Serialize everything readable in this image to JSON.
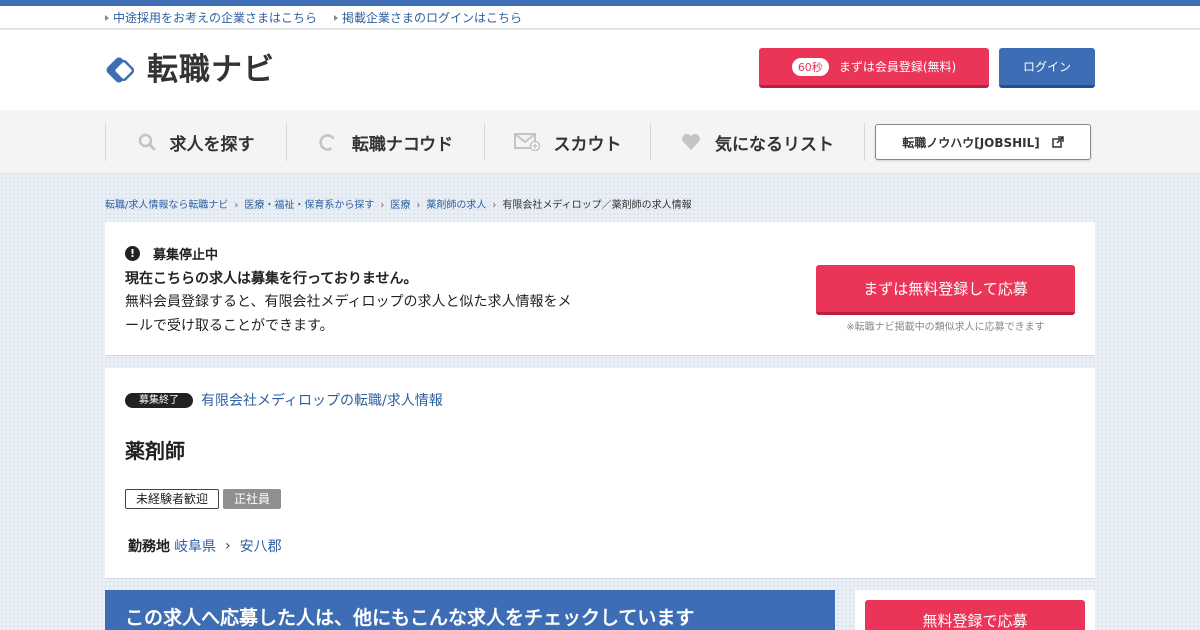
{
  "colors": {
    "brand_blue": "#3d6db5",
    "accent_pink": "#ea3558",
    "link": "#2f5fa0"
  },
  "util_links": [
    "中途採用をお考えの企業さまはこちら",
    "掲載企業さまのログインはこちら"
  ],
  "header": {
    "logo_text": "転職ナビ",
    "register_badge": "60秒",
    "register_label": "まずは会員登録(無料)",
    "login_label": "ログイン"
  },
  "nav": {
    "items": [
      {
        "label": "求人を探す",
        "icon": "search-icon"
      },
      {
        "label": "転職ナコウド",
        "icon": "nakoudo-icon"
      },
      {
        "label": "スカウト",
        "icon": "scout-mail-icon"
      },
      {
        "label": "気になるリスト",
        "icon": "heart-icon"
      }
    ],
    "knowhow_label": "転職ノウハウ[JOBSHIL]"
  },
  "breadcrumb": {
    "links": [
      "転職/求人情報なら転職ナビ",
      "医療・福祉・保育系から探す",
      "医療",
      "薬剤師の求人"
    ],
    "current": "有限会社メディロップ／薬剤師の求人情報"
  },
  "notice": {
    "title": "募集停止中",
    "lead": "現在こちらの求人は募集を行っておりません。",
    "desc": "無料会員登録すると、有限会社メディロップの求人と似た求人情報をメールで受け取ることができます。",
    "apply_label": "まずは無料登録して応募",
    "apply_note": "※転職ナビ掲載中の類似求人に応募できます"
  },
  "job": {
    "status_badge": "募集終了",
    "company_link": "有限会社メディロップの転職/求人情報",
    "title": "薬剤師",
    "tags": [
      "未経験者歓迎",
      "正社員"
    ],
    "location_label": "勤務地",
    "location": [
      "岐阜県",
      "安八郡"
    ]
  },
  "others_heading": "この求人へ応募した人は、他にもこんな求人をチェックしています",
  "side_apply_label": "無料登録で応募"
}
